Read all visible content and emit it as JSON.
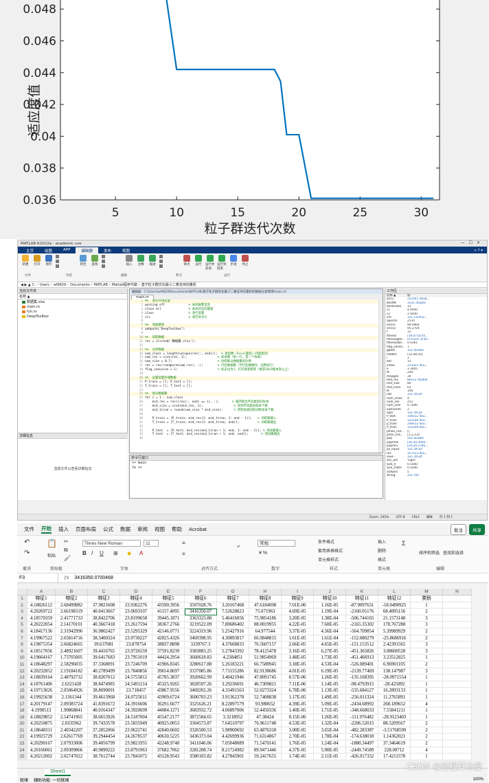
{
  "chart_data": {
    "type": "line",
    "title": "",
    "xlabel": "粒子群迭代次数",
    "ylabel": "适应度值",
    "xlim": [
      0.5,
      31.5
    ],
    "ylim": [
      0.036,
      0.049
    ],
    "xticks": [
      "5",
      "10",
      "15",
      "20",
      "25",
      "30"
    ],
    "yticks": [
      "0.036",
      "0.038",
      "0.04",
      "0.042",
      "0.044",
      "0.046",
      "0.048"
    ],
    "grid": false,
    "series": [
      {
        "x": [
          9.1,
          10,
          11,
          12,
          13,
          14,
          15,
          16,
          17,
          18,
          18.5,
          19,
          20,
          21,
          22,
          23,
          24,
          25,
          26,
          27,
          28,
          29,
          30,
          31
        ],
        "y": [
          0.049,
          0.0442,
          0.0442,
          0.0442,
          0.0442,
          0.0442,
          0.0442,
          0.0442,
          0.0442,
          0.0442,
          0.04345,
          0.0401,
          0.0401,
          0.0361,
          0.0361,
          0.0361,
          0.0361,
          0.0361,
          0.0361,
          0.0361,
          0.0361,
          0.0361,
          0.0361,
          0.0361
        ],
        "color": "#0072bd"
      }
    ]
  },
  "matlab": {
    "title": "MATLAB R2022a - academic use",
    "tabs": [
      "主页",
      "绘图",
      "APP",
      "编辑器",
      "发布",
      "视图"
    ],
    "active_tab": "编辑器",
    "ribbon_sections": [
      "文件",
      "导航",
      "编辑",
      "断点",
      "运行"
    ],
    "ribbon_buttons": [
      "新建",
      "打开",
      "保存",
      "转至",
      "查找",
      "插入",
      "注释",
      "缩进",
      "断点",
      "运行",
      "运行并前进",
      "运行到结束",
      "步进",
      "停止"
    ],
    "path": [
      "C:",
      "Users",
      "wl9629",
      "Documents",
      "MATLAB",
      "Matlab程序代做",
      "基于粒子群优化最小二乘支持向量机"
    ],
    "current_folder_label": "当前文件夹",
    "folder_header": "名称 ▲",
    "files": [
      "数据集.xlsx",
      "main.m",
      "fun.m",
      "DeepToolbox"
    ],
    "details_label": "详细信息",
    "details_msg": "选择文件以查看详细信息",
    "editor_path": "编辑器 - C:\\Users\\wl9629\\Documents\\MATLAB\\基于粒子群优化最小二乘支持向量机的数据分类预测\\main.m",
    "editor_tab": "main.m",
    "cmd_label": "命令行窗口",
    "cmd_lines": [
      ">> main",
      ">>"
    ],
    "fx": "fx",
    "workspace_label": "工作区",
    "workspace_header": [
      "名称 ▲",
      "值"
    ],
    "workspace": [
      [
        "accu",
        "253541 doub..."
      ],
      [
        "Bestfit",
        "1x31 double"
      ],
      [
        "bestindex",
        "12"
      ],
      [
        "c1",
        "4.4950"
      ],
      [
        "c2",
        "2.4440"
      ],
      [
        "cnt",
        "1x1 Confusi..."
      ],
      [
        "epochs",
        "2535"
      ],
      [
        "error1",
        "99.0964"
      ],
      [
        "error2",
        "95.2704"
      ],
      [
        "f",
        "12"
      ],
      [
        "fitness",
        "[18.0710.05..."
      ],
      [
        "fitnessgbe...",
        "[0.0316 ,0.04..."
      ],
      [
        "fitnesszbe...",
        "0.0361"
      ],
      [
        "flag_conso...",
        "1"
      ],
      [
        "gbest",
        "1x2 double"
      ],
      [
        "hidden",
        "[12,48,43]"
      ],
      [
        "i",
        "2"
      ],
      [
        "iter",
        "31"
      ],
      [
        "index",
        "2535x1 dou..."
      ],
      [
        "k",
        "3.3605"
      ],
      [
        "M",
        "249"
      ],
      [
        "maxgen",
        "30"
      ],
      [
        "mid_res",
        "80x12 double"
      ],
      [
        "mid_size",
        "80"
      ],
      [
        "mid_train",
        "63"
      ],
      [
        "N",
        "106"
      ],
      [
        "net",
        "1x1 struct"
      ],
      [
        "num_class",
        "4"
      ],
      [
        "num_res",
        "252"
      ],
      [
        "num_size",
        "0.7000"
      ],
      [
        "outnumm",
        "2"
      ],
      [
        "opts",
        "1x1 struct"
      ],
      [
        "P_test",
        "106x12 dou..."
      ],
      [
        "P_train",
        "12x146 dou..."
      ],
      [
        "p_train",
        "249x12 dou..."
      ],
      [
        "P_train",
        "12x249 dou..."
      ],
      [
        "pmax_ind...",
        "[]"
      ],
      [
        "pmin_ind...",
        "[1,2,3,4]"
      ],
      [
        "pop",
        "5x2 double"
      ],
      [
        "popmax",
        "[30,30,3000..."
      ],
      [
        "popmin",
        "[20,20,1500..."
      ],
      [
        "ps_input",
        "1x1 struct"
      ],
      [
        "res",
        "357x13 dou..."
      ],
      [
        "save",
        "1x1 struct"
      ],
      [
        "sec_act",
        "'sigm'"
      ],
      [
        "size_h",
        "0.5000"
      ],
      [
        "size_math",
        "0.5000"
      ],
      [
        "sizepos",
        "5"
      ],
      [
        "string",
        "2x1 cell"
      ]
    ],
    "code": [
      {
        "n": "1",
        "t": "%%  清空环境变量",
        "c": "cm"
      },
      {
        "n": "2",
        "t": "warning off",
        "c2": "             % 关闭报警信息"
      },
      {
        "n": "3",
        "t": "close all",
        "c2": "               % 关闭开启的图窗"
      },
      {
        "n": "4",
        "t": "clear",
        "c2": "                   % 清空变量"
      },
      {
        "n": "5",
        "t": "clc",
        "c2": "                     % 清空命令行"
      },
      {
        "n": "6",
        "t": ""
      },
      {
        "n": "7",
        "t": "%%  添加路径",
        "c": "cm"
      },
      {
        "n": "8",
        "t": "addpath(\"DeepToolbox\")"
      },
      {
        "n": "9",
        "t": ""
      },
      {
        "n": "10",
        "t": "%%  读取数据",
        "c": "cm"
      },
      {
        "n": "11",
        "t": "res = xlsread('数据集.xlsx');"
      },
      {
        "n": "12",
        "t": ""
      },
      {
        "n": "13",
        "t": "%%  分析数据",
        "c": "cm"
      },
      {
        "n": "14",
        "t": "num_class = length(unique(res(:, end)));",
        "c2": "  % 类别数（Excel最后一列放类别）"
      },
      {
        "n": "15",
        "t": "num_res = size(res, 1);",
        "c2": "                 % 样本数（每一行，是一个样本）"
      },
      {
        "n": "16",
        "t": "num_size = 0.7;",
        "c2": "                         % 训练集占数据集的比例"
      },
      {
        "n": "17",
        "t": "res = res(randperm(num_res), :);",
        "c2": "        % 打乱数据集（不打乱数据时，注释该行）"
      },
      {
        "n": "18",
        "t": "flag_conusion = 1;",
        "c2": "                      % 标志位为1，打开混淆矩阵（要求2018版本及以上）"
      },
      {
        "n": "19",
        "t": ""
      },
      {
        "n": "20",
        "t": "%%  设置变量存储数据",
        "c": "cm"
      },
      {
        "n": "21",
        "t": "P_train = []; P_test = [];"
      },
      {
        "n": "22",
        "t": "T_train = []; T_test = [];"
      },
      {
        "n": "23",
        "t": ""
      },
      {
        "n": "24",
        "t": "%%  划分数据集",
        "c": "cm"
      },
      {
        "n": "25",
        "t": "for i = 1 : num_class"
      },
      {
        "n": "26",
        "t": "    mid_res = res((res(:, end) == i), :);",
        "c2": "       % 循环取出不同类别的样本"
      },
      {
        "n": "27",
        "t": "    mid_size = size(mid_res, 1);",
        "c2": "                 % 得到不同类别样本个数"
      },
      {
        "n": "28",
        "t": "    mid_tiran = round(num_size * mid_size);",
        "c2": "      % 得到该类别的训练样本个数"
      },
      {
        "n": "29",
        "t": ""
      },
      {
        "n": "30",
        "t": "    P_train = [P_train; mid_res(1: mid_tiran, 1: end - 1)];",
        "c2": "   % 训练集输入"
      },
      {
        "n": "31",
        "t": "    T_train = [T_train; mid_res(1: mid_tiran, end)];",
        "c2": "          % 训练集输出"
      },
      {
        "n": "32",
        "t": ""
      },
      {
        "n": "33",
        "t": "    P_test  = [P_test; mid_res(mid_tiran + 1: end, 1: end - 1)];",
        "c2": " % 测试集输入"
      },
      {
        "n": "34",
        "t": "    T_test  = [T_test; mid_res(mid_tiran + 1: end, end)];",
        "c2": "       % 测试集输出"
      },
      {
        "n": "35",
        "t": ""
      }
    ],
    "status": [
      "Zoom: 105%",
      "UTF-8",
      "CRLF",
      "脚本",
      "行 1 列 1"
    ]
  },
  "excel": {
    "menu": [
      "文件",
      "开始",
      "插入",
      "页面布局",
      "公式",
      "数据",
      "审阅",
      "视图",
      "帮助",
      "Acrobat"
    ],
    "active_menu": "开始",
    "comment_btn": "批注",
    "share_btn": "共享",
    "groups": [
      "撤消",
      "剪贴板",
      "字体",
      "对齐方式",
      "数字",
      "样式",
      "单元格",
      "编辑"
    ],
    "paste": "粘贴",
    "font_name": "Times New Roman",
    "font_size": "11",
    "number_format": "常规",
    "styles": [
      "条件格式",
      "套用表格格式",
      "单元格样式"
    ],
    "cells_btns": [
      "插入",
      "删除",
      "格式"
    ],
    "edit_btns": [
      "排序和筛选",
      "查找和选择"
    ],
    "name_box": "F3",
    "formula_value": "3416350.0700468",
    "columns": [
      "A",
      "B",
      "C",
      "D",
      "E",
      "F",
      "G",
      "H",
      "I",
      "J",
      "K",
      "L",
      "M",
      "N"
    ],
    "rows": [
      [
        "1",
        "特征1",
        "特征2",
        "特征3",
        "特征4",
        "特征5",
        "特征6",
        "特征7",
        "特征8",
        "特征9",
        "特征10",
        "特征11",
        "特征12",
        "类别",
        ""
      ],
      [
        "2",
        "4.18826112",
        "2.68499882",
        "37.9821608",
        "23.9362276",
        "43590.3956",
        "3507028.76",
        "3.20107468",
        "47.6184098",
        "7.01E-06",
        "1.16E-05",
        "-87.9097631",
        "-18.0490925",
        "1",
        ""
      ],
      [
        "3",
        "4.20269722",
        "2.66198319",
        "40.0413667",
        "23.0693107",
        "41157.4095",
        "3416350.07",
        "7.52628823",
        "75.071963",
        "4.69E-05",
        "1.19E-04",
        "-2160.05176",
        "68.4095156",
        "2",
        ""
      ],
      [
        "4",
        "4.18570359",
        "2.41771733",
        "38.8422706",
        "23.8199658",
        "39445.1871",
        "3363323.88",
        "5.46416056",
        "75.9854186",
        "3.20E-05",
        "1.38E-04",
        "-506.744165",
        "21.1573148",
        "3",
        ""
      ],
      [
        "5",
        "4.20222054",
        "2.14170101",
        "40.3667418",
        "23.2617594",
        "38367.2766",
        "3219522.09",
        "7.80686402",
        "88.0019955",
        "4.22E-05",
        "7.60E-05",
        "-2165.35302",
        "178.767288",
        "3",
        ""
      ],
      [
        "6",
        "4.18417136",
        "2.31942996",
        "36.9802427",
        "23.5295329",
        "42146.0771",
        "3224319.96",
        "5.25427916",
        "64.977544",
        "3.37E-05",
        "4.56E-04",
        "-564.709854",
        "5.39989929",
        "2",
        ""
      ],
      [
        "7",
        "4.19967522",
        "2.65814716",
        "38.3400324",
        "23.9730227",
        "42825.4326",
        "3469398.95",
        "4.30893817",
        "66.9848815",
        "1.61E-05",
        "1.61E-04",
        "-152.080279",
        "-25.8686916",
        "2",
        ""
      ],
      [
        "8",
        "4.19875354",
        "2.66824665",
        "39.637081",
        "23.878754",
        "38837.8898",
        "3339767.3",
        "4.37668833",
        "76.5607157",
        "2.66E-05",
        "4.65E-05",
        "-151.153512",
        "2.42391565",
        "3",
        ""
      ],
      [
        "9",
        "4.18517056",
        "2.48921607",
        "39.4416765",
        "23.9726559",
        "37591.8239",
        "3383883.25",
        "5.27843392",
        "78.4125478",
        "3.16E-05",
        "6.27E-05",
        "-451.365826",
        "3.08600528",
        "3",
        ""
      ],
      [
        "10",
        "4.19664167",
        "1.73705005",
        "39.6417683",
        "23.7951019",
        "44424.2954",
        "3660618.83",
        "4.2384851",
        "51.9854969",
        "1.48E-05",
        "1.73E-05",
        "-451.466913",
        "3.23512825",
        "1",
        ""
      ],
      [
        "11",
        "4.18648297",
        "2.58296035",
        "37.3368091",
        "23.7246709",
        "41906.8345",
        "3280617.88",
        "5.26183221",
        "66.7588945",
        "3.18E-05",
        "4.53E-04",
        "-526.089401",
        "6.96901105",
        "2",
        ""
      ],
      [
        "12",
        "4.20232852",
        "2.19184182",
        "40.2789499",
        "23.7840856",
        "39654.8697",
        "3337085.86",
        "7.71155286",
        "82.9138686",
        "4.01E-05",
        "6.19E-05",
        "-2139.77469",
        "138.147987",
        "3",
        ""
      ],
      [
        "13",
        "4.18839164",
        "2.48792732",
        "38.8207012",
        "24.5755812",
        "45785.3837",
        "3920662.99",
        "3.40421946",
        "47.8091745",
        "8.57E-06",
        "1.26E-05",
        "-135.168395",
        "-28.0971554",
        "1",
        ""
      ],
      [
        "14",
        "4.18761406",
        "2.6321428",
        "38.8474985",
        "24.5491214",
        "45325.9265",
        "3828597.26",
        "3.29236691",
        "46.7309821",
        "7.11E-06",
        "1.14E-05",
        "-98.4793915",
        "-28.425892",
        "1",
        ""
      ],
      [
        "15",
        "4.19713026",
        "2.05064926",
        "38.8690691",
        "23.718457",
        "43867.9556",
        "3469202.26",
        "4.33491563",
        "52.0273324",
        "6.78E-06",
        "1.13E-05",
        "-535.684127",
        "16.2893133",
        "1",
        ""
      ],
      [
        "16",
        "4.19925638",
        "2.1361344",
        "39.4613968",
        "24.0725011",
        "43909.6724",
        "3600703.23",
        "3.91362378",
        "52.7408838",
        "1.17E-05",
        "1.49E-05",
        "-256.011324",
        "11.2765891",
        "1",
        ""
      ],
      [
        "17",
        "4.20179147",
        "2.09385724",
        "41.8391672",
        "24.3916606",
        "36291.6677",
        "3325626.21",
        "8.22897579",
        "93.980652",
        "4.39E-05",
        "5.09E-05",
        "-2434.68992",
        "268.189652",
        "4",
        ""
      ],
      [
        "18",
        "4.1990513",
        "1.90868841",
        "40.0164347",
        "24.3920699",
        "44084.1271",
        "3683932.72",
        "4.06897006",
        "52.4450336",
        "1.40E-05",
        "1.71E-05",
        "-348.668033",
        "7.55841211",
        "1",
        ""
      ],
      [
        "19",
        "4.18829852",
        "2.54741965",
        "38.6653926",
        "24.5187004",
        "45547.2177",
        "3872584.65",
        "3.3218952",
        "47.38424",
        "8.15E-06",
        "1.26E-05",
        "-111.976482",
        "-28.9123403",
        "1",
        ""
      ],
      [
        "20",
        "4.20250875",
        "2.0335962",
        "39.7433578",
        "23.5835949",
        "40925.0053",
        "3304573.87",
        "7.64510797",
        "76.9611748",
        "4.53E-05",
        "1.32E-04",
        "-2206.52015",
        "88.5209567",
        "2",
        ""
      ],
      [
        "21",
        "4.18648311",
        "2.40342207",
        "37.2852066",
        "23.9622741",
        "42840.6602",
        "3326500.53",
        "5.98900692",
        "63.4876318",
        "3.00E-05",
        "3.65E-04",
        "-482.283387",
        "-3.51768599",
        "2",
        ""
      ],
      [
        "22",
        "4.19925729",
        "2.62617769",
        "39.2944454",
        "24.2678537",
        "40630.5225",
        "3436373.04",
        "4.42699936",
        "71.6314867",
        "2.70E-05",
        "1.78E-04",
        "-174.638018",
        "1.14362021",
        "2",
        ""
      ],
      [
        "23",
        "4.20290167",
        "2.07933006",
        "39.4056799",
        "23.9821955",
        "42248.9748",
        "3411046.06",
        "7.05048089",
        "71.5470141",
        "1.76E-05",
        "1.24E-04",
        "-1880.34497",
        "37.3464619",
        "2",
        ""
      ],
      [
        "24",
        "4.20166061",
        "2.09309866",
        "40.9890222",
        "23.8791963",
        "37682.7062",
        "3281208.74",
        "8.21724982",
        "89.9471446",
        "4.37E-05",
        "5.90E-05",
        "-2449.74589",
        "228.00712",
        "4",
        ""
      ],
      [
        "25",
        "4.20212002",
        "2.02747022",
        "38.7612744",
        "23.7841072",
        "43128.9543",
        "3580103.82",
        "4.27845901",
        "59.2417655",
        "1.74E-05",
        "2.11E-05",
        "-426.917332",
        "17.4211578",
        "1",
        ""
      ]
    ],
    "sheet": "Sheet1",
    "status_left": [
      "就绪",
      "辅助功能: 一切就绪"
    ],
    "zoom": "100%",
    "watermark": "CSDN @前程算法屋"
  }
}
